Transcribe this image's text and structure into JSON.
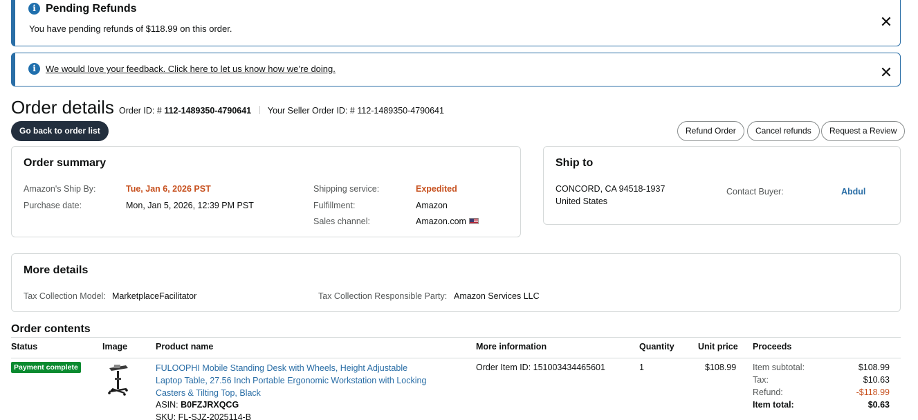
{
  "alerts": {
    "pending": {
      "title": "Pending Refunds",
      "text": "You have pending refunds of $118.99 on this order.",
      "close": "✕"
    },
    "feedback": {
      "link": "We would love your feedback. Click here to let us know how we’re doing.",
      "close": "✕"
    },
    "info_icon": "i"
  },
  "header": {
    "title": "Order details",
    "order_id_label": "Order ID: #",
    "order_id": "112-1489350-4790641",
    "seller_order_label": "Your Seller Order ID: #",
    "seller_order_id": "112-1489350-4790641"
  },
  "actions": {
    "back": "Go back to order list",
    "refund": "Refund Order",
    "cancel_refunds": "Cancel refunds",
    "request_review": "Request a Review"
  },
  "order_summary": {
    "title": "Order summary",
    "ship_by_label": "Amazon's Ship By:",
    "ship_by_value": "Tue, Jan 6, 2026 PST",
    "purchase_label": "Purchase date:",
    "purchase_value": "Mon, Jan 5, 2026, 12:39 PM PST",
    "shipping_service_label": "Shipping service:",
    "shipping_service_value": "Expedited",
    "fulfillment_label": "Fulfillment:",
    "fulfillment_value": "Amazon",
    "sales_channel_label": "Sales channel:",
    "sales_channel_value": "Amazon.com"
  },
  "ship_to": {
    "title": "Ship to",
    "address_line1": "CONCORD, CA 94518-1937",
    "address_line2": "United States",
    "contact_label": "Contact Buyer:",
    "contact_value": "Abdul"
  },
  "more_details": {
    "title": "More details",
    "tax_model_label": "Tax Collection Model:",
    "tax_model_value": "MarketplaceFacilitator",
    "tax_party_label": "Tax Collection Responsible Party:",
    "tax_party_value": "Amazon Services LLC"
  },
  "order_contents": {
    "title": "Order contents",
    "columns": [
      "Status",
      "Image",
      "Product name",
      "More information",
      "Quantity",
      "Unit price",
      "Proceeds"
    ],
    "item": {
      "status": "Payment complete",
      "product_name": "FULOOPHI Mobile Standing Desk with Wheels, Height Adjustable Laptop Table, 27.56 Inch Portable Ergonomic Workstation with Locking Casters & Tilting Top, Black",
      "asin_label": "ASIN:",
      "asin": "B0FZJRXQCG",
      "sku_label": "SKU:",
      "sku": "FL-SJZ-2025114-B",
      "more_info": "Order Item ID: 151003434465601",
      "quantity": "1",
      "unit_price": "$108.99",
      "proceeds": {
        "subtotal_label": "Item subtotal:",
        "subtotal": "$108.99",
        "tax_label": "Tax:",
        "tax": "$10.63",
        "refund_label": "Refund:",
        "refund": "-$118.99",
        "total_label": "Item total:",
        "total": "$0.63"
      }
    }
  },
  "colors": {
    "accent_blue": "#2a6ea6",
    "orange": "#c7511f",
    "status_green": "#0a8a2f",
    "dark_button": "#232f3e"
  },
  "icons": {
    "info": "info-icon",
    "close": "close-icon",
    "flag": "us-flag-icon",
    "product": "product-thumbnail"
  }
}
